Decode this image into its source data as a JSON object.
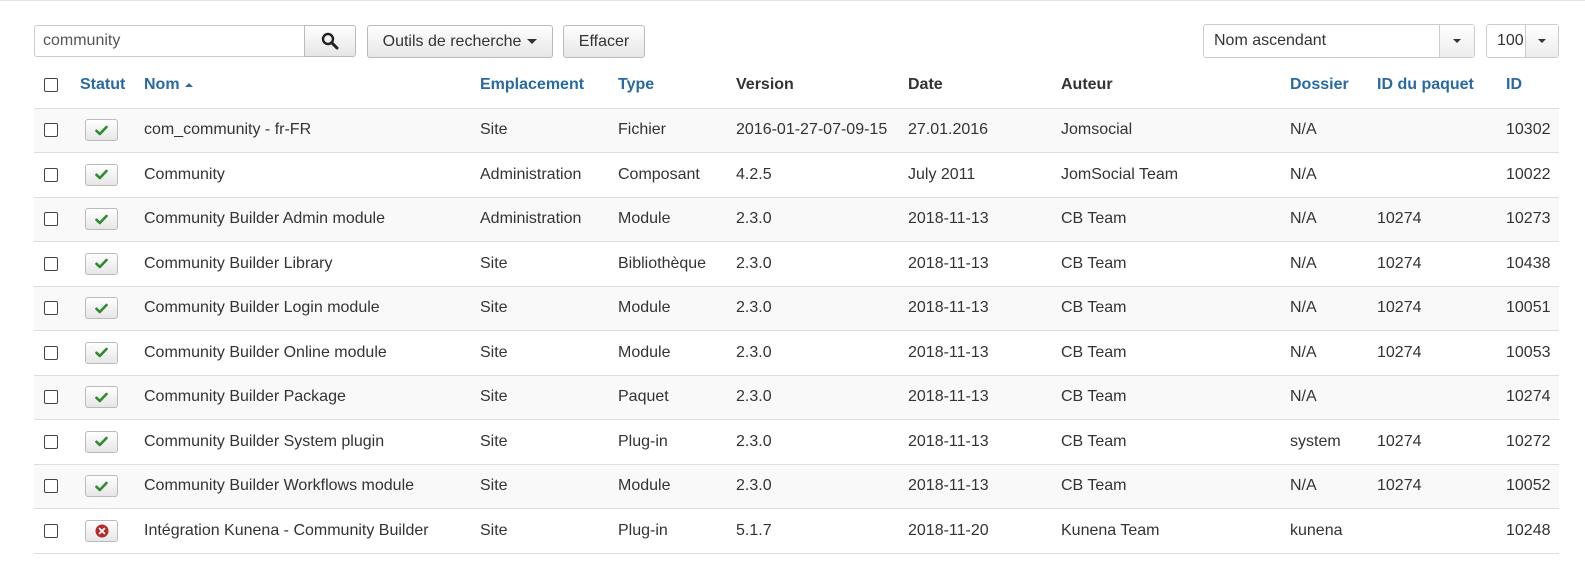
{
  "toolbar": {
    "search_value": "community",
    "search_tools_label": "Outils de recherche",
    "clear_label": "Effacer",
    "sort_value": "Nom ascendant",
    "limit_value": "100"
  },
  "colors": {
    "link": "#2a6aa3",
    "published": "#2e8b2e",
    "unpublished": "#b52a2a"
  },
  "table": {
    "headers": {
      "status": "Statut",
      "name": "Nom",
      "location": "Emplacement",
      "type": "Type",
      "version": "Version",
      "date": "Date",
      "author": "Auteur",
      "folder": "Dossier",
      "package_id": "ID du paquet",
      "id": "ID"
    },
    "rows": [
      {
        "status": "check-icon",
        "name": "com_community - fr-FR",
        "location": "Site",
        "type": "Fichier",
        "version": "2016-01-27-07-09-15",
        "date": "27.01.2016",
        "author": "Jomsocial",
        "folder": "N/A",
        "package_id": "",
        "id": "10302"
      },
      {
        "status": "check-icon",
        "name": "Community",
        "location": "Administration",
        "type": "Composant",
        "version": "4.2.5",
        "date": "July 2011",
        "author": "JomSocial Team",
        "folder": "N/A",
        "package_id": "",
        "id": "10022"
      },
      {
        "status": "check-icon",
        "name": "Community Builder Admin module",
        "location": "Administration",
        "type": "Module",
        "version": "2.3.0",
        "date": "2018-11-13",
        "author": "CB Team",
        "folder": "N/A",
        "package_id": "10274",
        "id": "10273"
      },
      {
        "status": "check-icon",
        "name": "Community Builder Library",
        "location": "Site",
        "type": "Bibliothèque",
        "version": "2.3.0",
        "date": "2018-11-13",
        "author": "CB Team",
        "folder": "N/A",
        "package_id": "10274",
        "id": "10438"
      },
      {
        "status": "check-icon",
        "name": "Community Builder Login module",
        "location": "Site",
        "type": "Module",
        "version": "2.3.0",
        "date": "2018-11-13",
        "author": "CB Team",
        "folder": "N/A",
        "package_id": "10274",
        "id": "10051"
      },
      {
        "status": "check-icon",
        "name": "Community Builder Online module",
        "location": "Site",
        "type": "Module",
        "version": "2.3.0",
        "date": "2018-11-13",
        "author": "CB Team",
        "folder": "N/A",
        "package_id": "10274",
        "id": "10053"
      },
      {
        "status": "check-icon",
        "name": "Community Builder Package",
        "location": "Site",
        "type": "Paquet",
        "version": "2.3.0",
        "date": "2018-11-13",
        "author": "CB Team",
        "folder": "N/A",
        "package_id": "",
        "id": "10274"
      },
      {
        "status": "check-icon",
        "name": "Community Builder System plugin",
        "location": "Site",
        "type": "Plug-in",
        "version": "2.3.0",
        "date": "2018-11-13",
        "author": "CB Team",
        "folder": "system",
        "package_id": "10274",
        "id": "10272"
      },
      {
        "status": "check-icon",
        "name": "Community Builder Workflows module",
        "location": "Site",
        "type": "Module",
        "version": "2.3.0",
        "date": "2018-11-13",
        "author": "CB Team",
        "folder": "N/A",
        "package_id": "10274",
        "id": "10052"
      },
      {
        "status": "x-circle-icon",
        "name": "Intégration Kunena - Community Builder",
        "location": "Site",
        "type": "Plug-in",
        "version": "5.1.7",
        "date": "2018-11-20",
        "author": "Kunena Team",
        "folder": "kunena",
        "package_id": "",
        "id": "10248"
      }
    ]
  }
}
